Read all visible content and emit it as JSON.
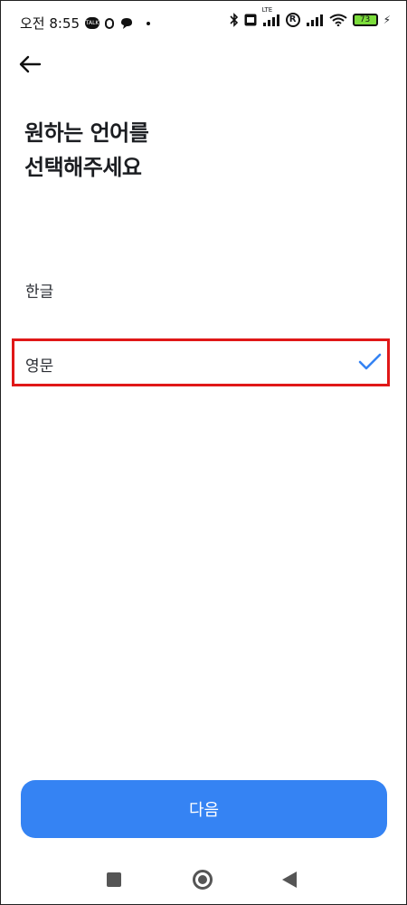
{
  "status_bar": {
    "time": "오전 8:55",
    "talk_badge": "TALK",
    "network": "LTE",
    "roaming": "R",
    "battery": "73"
  },
  "header": {
    "title_line1": "원하는 언어를",
    "title_line2": "선택해주세요"
  },
  "languages": [
    {
      "label": "한글",
      "selected": false
    },
    {
      "label": "영문",
      "selected": true
    }
  ],
  "footer": {
    "next_label": "다음"
  },
  "colors": {
    "accent": "#3583f3",
    "check": "#3583f3",
    "highlight": "#e01818"
  }
}
